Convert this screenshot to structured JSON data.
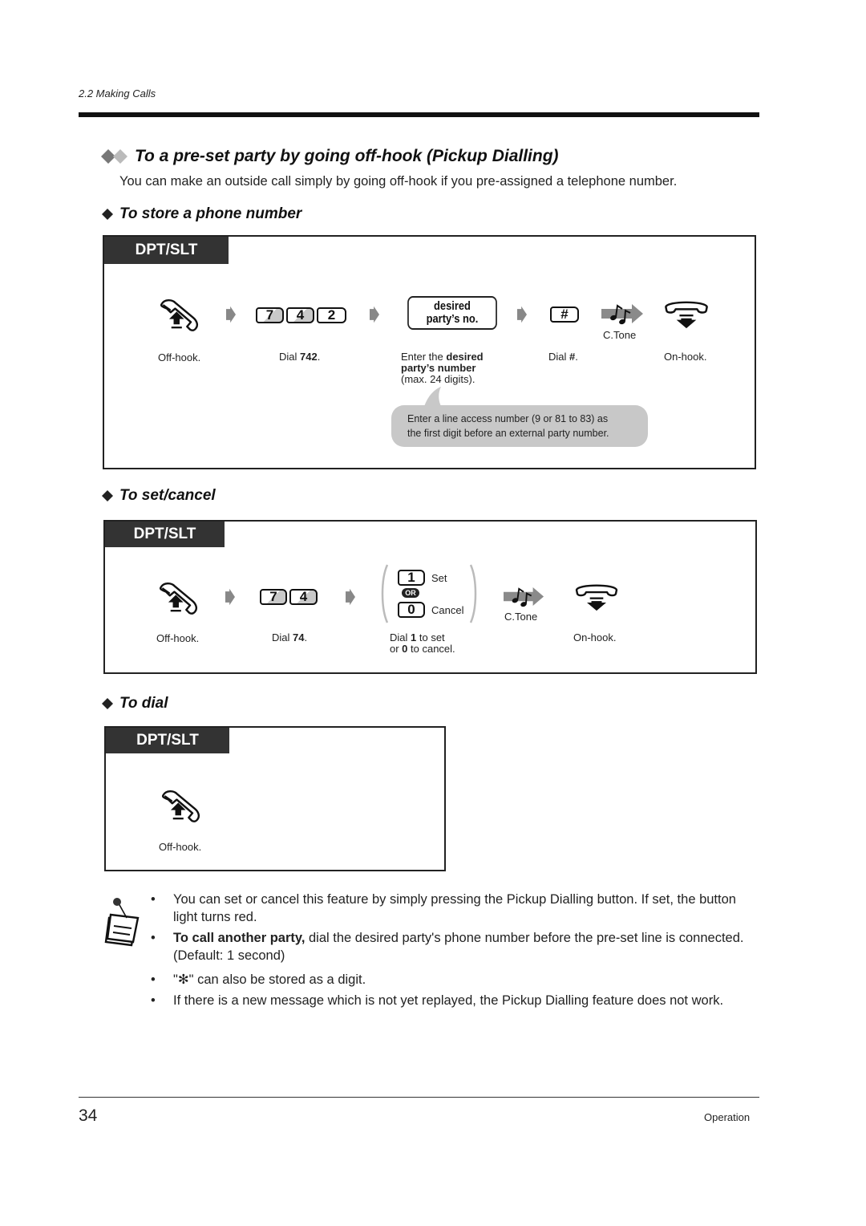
{
  "running_head": "2.2   Making Calls",
  "title": "To a pre-set party by going off-hook (Pickup Dialling)",
  "intro": "You can make an outside call simply by going off-hook if you pre-assigned a telephone number.",
  "sections": {
    "store": {
      "heading": "To store a phone number",
      "tag": "DPT/SLT",
      "steps": {
        "offhook": "Off-hook.",
        "dial_prefix": "Dial ",
        "dial_code": "742",
        "dial_suffix": ".",
        "keys": [
          "7",
          "4",
          "2"
        ],
        "party_box_line1": "desired",
        "party_box_line2": "party’s no.",
        "enter_prefix": "Enter the ",
        "enter_bold1": "desired",
        "enter_bold2": "party’s number",
        "enter_suffix": "(max. 24 digits).",
        "hash_key": "#",
        "dial_hash_prefix": "Dial ",
        "dial_hash_bold": "#",
        "dial_hash_suffix": ".",
        "ctone": "C.Tone",
        "onhook": "On-hook."
      },
      "note_line1": "Enter a line access number (9 or 81 to 83) as",
      "note_line2": "the first digit before an external party number."
    },
    "setcancel": {
      "heading": "To set/cancel",
      "tag": "DPT/SLT",
      "steps": {
        "offhook": "Off-hook.",
        "keys": [
          "7",
          "4"
        ],
        "dial_prefix": "Dial ",
        "dial_code": "74",
        "dial_suffix": ".",
        "set_key": "1",
        "set_label": "Set",
        "or_label": "OR",
        "cancel_key": "0",
        "cancel_label": "Cancel",
        "choice_l1_prefix": "Dial ",
        "choice_l1_bold": "1",
        "choice_l1_suffix": " to set",
        "choice_l2_prefix": "or ",
        "choice_l2_bold": "0",
        "choice_l2_suffix": " to cancel.",
        "ctone": "C.Tone",
        "onhook": "On-hook."
      }
    },
    "dial": {
      "heading": "To dial",
      "tag": "DPT/SLT",
      "steps": {
        "offhook": "Off-hook."
      }
    }
  },
  "notes": [
    {
      "bold": "",
      "text": "You can set or cancel this feature by simply pressing the Pickup Dialling button. If set, the button light turns red."
    },
    {
      "bold": "To call another party,",
      "text": " dial the desired party's phone number before the pre-set line is connected.",
      "extra": "(Default: 1 second)"
    },
    {
      "bold": "",
      "text": "\"✻\" can also be stored as a digit."
    },
    {
      "bold": "",
      "text": "If there is a new message which is not yet replayed, the Pickup Dialling feature does not work."
    }
  ],
  "bullet_char": "•",
  "footer": {
    "page_number": "34",
    "section": "Operation"
  }
}
